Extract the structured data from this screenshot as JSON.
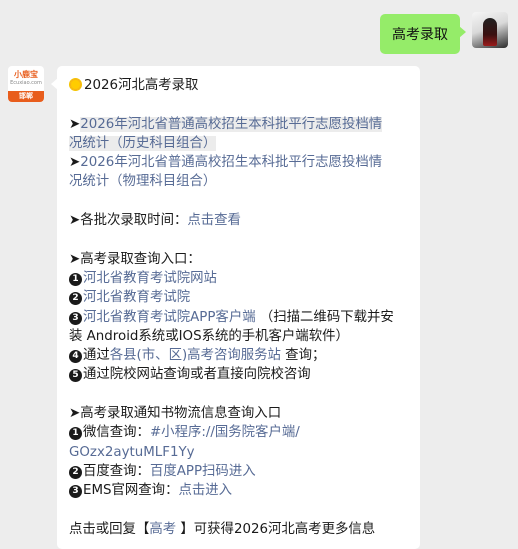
{
  "outgoing": {
    "text": "高考录取"
  },
  "bot": {
    "avatar_brand": "小鹿宝",
    "avatar_site": "Ecuxiao.com",
    "avatar_city": "邯郸"
  },
  "message": {
    "title": "2026河北高考录取",
    "doc1_link": "2026年河北省普通高校招生本科批平行志愿投档情况统计（历史科目组合）",
    "doc1_line1": "2026年河北省普通高校招生本科批平行志愿投档情",
    "doc1_line2": "况统计（历史科目组合）",
    "doc2_line1": "2026年河北省普通高校招生本科批平行志愿投档情",
    "doc2_line2": "况统计（物理科目组合）",
    "batch_label": "各批次录取时间：",
    "batch_link": "点击查看",
    "entry_title": "高考录取查询入口：",
    "entry1": "河北省教育考试院网站",
    "entry2": "河北省教育考试院",
    "entry3_link": "河北省教育考试院APP客户端",
    "entry3_rest1": " （扫描二维码下载并安",
    "entry3_rest2": "装 Android系统或IOS系统的手机客户端软件）",
    "entry4_pre": "通过",
    "entry4_link": "各县(市、区)高考咨询服务站",
    "entry4_post": " 查询；",
    "entry5": "通过院校网站查询或者直接向院校咨询",
    "notice_title": "高考录取通知书物流信息查询入口",
    "n1_label": "微信查询：",
    "n1_link1": "#小程序://国务院客户端/",
    "n1_link2": "GOzx2aytuMLF1Yy",
    "n2_label": "百度查询：",
    "n2_link": "百度APP扫码进入",
    "n3_label": "EMS官网查询：",
    "n3_link": "点击进入",
    "footer_pre": "点击或回复【",
    "footer_link": "高考",
    "footer_post": " 】可获得2026河北高考更多信息"
  },
  "colors": {
    "bubble_out": "#95ec69",
    "link": "#576b95",
    "background": "#ededed"
  }
}
